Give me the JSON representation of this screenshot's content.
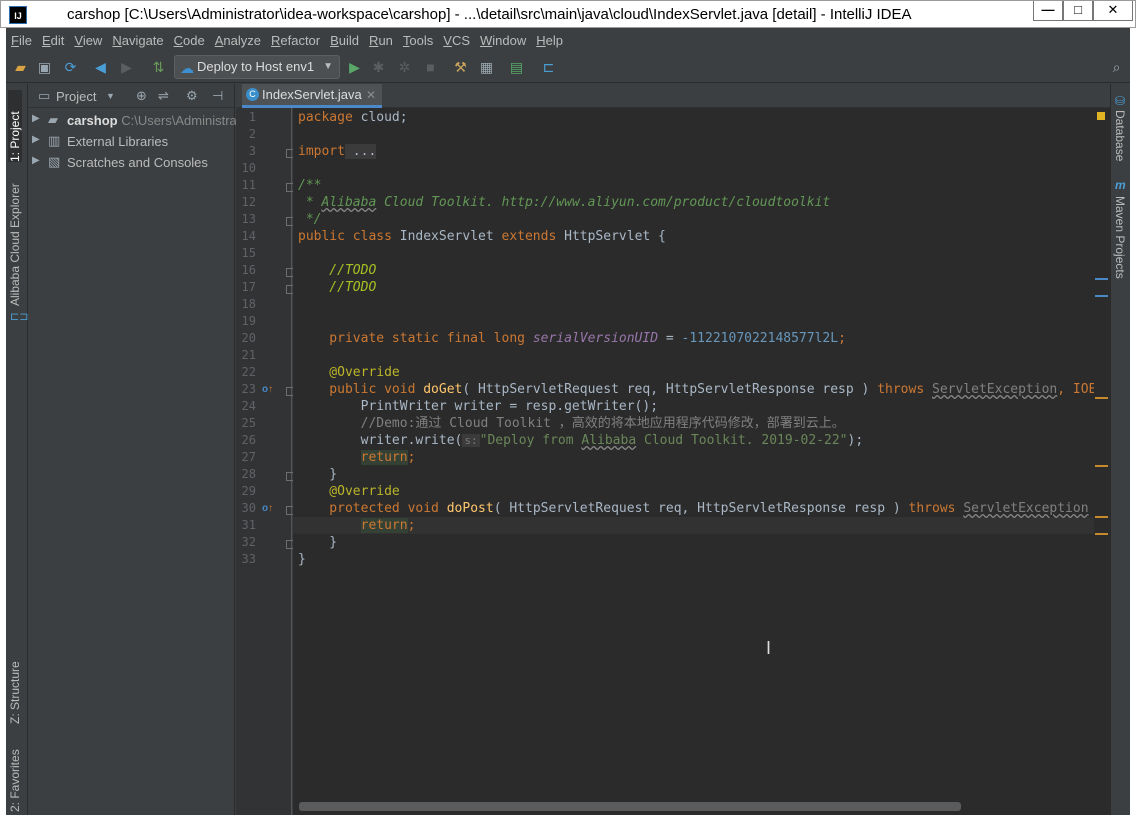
{
  "window": {
    "title": "carshop [C:\\Users\\Administrator\\idea-workspace\\carshop] - ...\\detail\\src\\main\\java\\cloud\\IndexServlet.java [detail] - IntelliJ IDEA",
    "app_icon": "IJ",
    "minimize": "—",
    "maximize": "□",
    "close": "✕"
  },
  "menu": [
    "File",
    "Edit",
    "View",
    "Navigate",
    "Code",
    "Analyze",
    "Refactor",
    "Build",
    "Run",
    "Tools",
    "VCS",
    "Window",
    "Help"
  ],
  "toolbar": {
    "run_config": "Deploy to Host env1",
    "icons": [
      "open-icon",
      "save-icon",
      "sync-icon",
      "back-icon",
      "forward-icon",
      "build-icon",
      "run-icon",
      "debug-icon",
      "coverage-icon",
      "stop-icon",
      "project-structure-icon",
      "sdk-icon",
      "tasks-icon",
      "cloud-explorer-icon",
      "search-icon"
    ]
  },
  "left_stripe": {
    "project": "1: Project",
    "cloud_explorer": "Alibaba Cloud Explorer",
    "structure": "Z: Structure",
    "favorites": "2: Favorites"
  },
  "project_panel": {
    "header": "Project",
    "tree": [
      {
        "name": "carshop",
        "path": "C:\\Users\\Administra"
      },
      {
        "name": "External Libraries"
      },
      {
        "name": "Scratches and Consoles"
      }
    ]
  },
  "editor": {
    "tab": "IndexServlet.java",
    "line_numbers": [
      "1",
      "2",
      "3",
      "10",
      "11",
      "12",
      "13",
      "14",
      "15",
      "16",
      "17",
      "18",
      "19",
      "20",
      "21",
      "22",
      "23",
      "24",
      "25",
      "26",
      "27",
      "28",
      "29",
      "30",
      "31",
      "32",
      "33"
    ],
    "code": {
      "l1_kw": "package",
      "l1_rest": " cloud;",
      "l3_kw": "import",
      "l3_rest": " ...",
      "l11": "/**",
      "l12_pre": " * ",
      "l12_a": "Alibaba",
      "l12_b": " Cloud Toolkit. http://www.aliyun.com/product/cloudtoolkit",
      "l13": " */",
      "l14_kw": "public class",
      "l14_a": " IndexServlet ",
      "l14_kw2": "extends",
      "l14_b": " HttpServlet {",
      "l16": "    //TODO",
      "l17": "    //TODO",
      "l20_kw": "    private static final long ",
      "l20_fld": "serialVersionUID",
      "l20_eq": " = ",
      "l20_num": "-1122107022148577l2L",
      "l20_end": ";",
      "l22": "    @Override",
      "l23_kw": "    public void ",
      "l23_fn": "doGet",
      "l23_a": "( HttpServletRequest req, HttpServletResponse resp ) ",
      "l23_kw2": "throws",
      "l23_b": " ",
      "l23_exc": "ServletException",
      "l23_c": ", IOE",
      "l24": "        PrintWriter writer = resp.getWriter();",
      "l25_a": "        //Demo:",
      "l25_b": "通过 Cloud Toolkit ，高效的将本地应用程序代码修改，部署到云上。",
      "l26_a": "        writer.write(",
      "l26_hint": "s:",
      "l26_s1": "\"Deploy from ",
      "l26_s2": "Alibaba",
      "l26_s3": " Cloud Toolkit. 2019-02-22\"",
      "l26_end": ");",
      "l27_kw": "return",
      "l27_end": ";",
      "l28": "    }",
      "l29": "    @Override",
      "l30_kw": "    protected void ",
      "l30_fn": "doPost",
      "l30_a": "( HttpServletRequest req, HttpServletResponse resp ) ",
      "l30_kw2": "throws",
      "l30_b": " ",
      "l30_exc": "ServletException",
      "l31_kw": "return",
      "l31_end": ";",
      "l32": "    }",
      "l33": "}"
    }
  },
  "right_stripe": {
    "database": "Database",
    "maven": "Maven Projects"
  },
  "colors": {
    "editor_bg": "#2b2b2b",
    "keyword": "#cc7832",
    "string": "#6a8759",
    "number": "#6897bb",
    "function": "#ffc66d",
    "annotation": "#bbb529",
    "comment": "#808080",
    "doc_comment": "#629755"
  }
}
